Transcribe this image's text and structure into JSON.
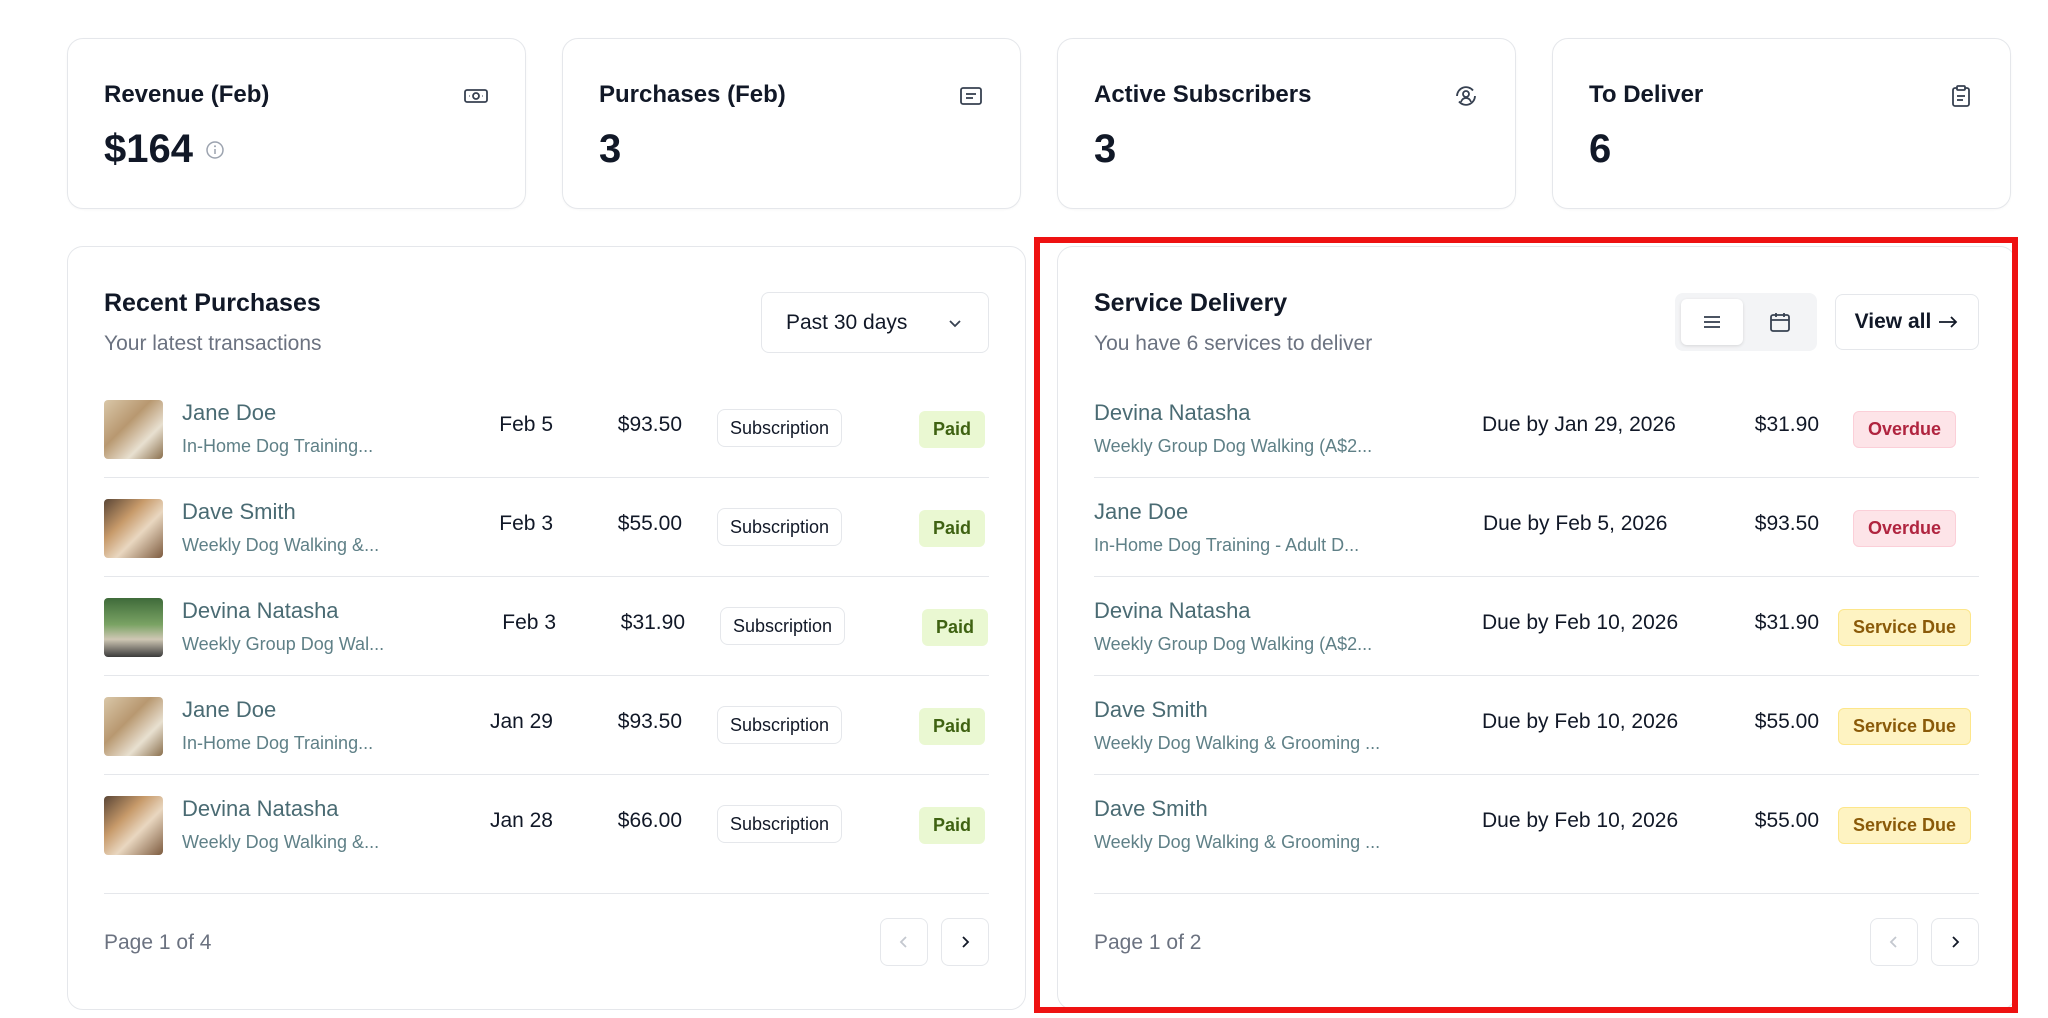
{
  "stats": [
    {
      "title": "Revenue (Feb)",
      "value": "$164",
      "icon": "banknote-icon",
      "has_info": true
    },
    {
      "title": "Purchases (Feb)",
      "value": "3",
      "icon": "receipt-icon"
    },
    {
      "title": "Active Subscribers",
      "value": "3",
      "icon": "user-cycle-icon"
    },
    {
      "title": "To Deliver",
      "value": "6",
      "icon": "clipboard-icon"
    }
  ],
  "recent_purchases": {
    "title": "Recent Purchases",
    "subtitle": "Your latest transactions",
    "filter": "Past 30 days",
    "rows": [
      {
        "name": "Jane Doe",
        "desc": "In-Home Dog Training...",
        "date": "Feb 5",
        "amount": "$93.50",
        "type": "Subscription",
        "status": "Paid"
      },
      {
        "name": "Dave Smith",
        "desc": "Weekly Dog Walking &...",
        "date": "Feb 3",
        "amount": "$55.00",
        "type": "Subscription",
        "status": "Paid"
      },
      {
        "name": "Devina Natasha",
        "desc": "Weekly Group Dog Wal...",
        "date": "Feb 3",
        "amount": "$31.90",
        "type": "Subscription",
        "status": "Paid"
      },
      {
        "name": "Jane Doe",
        "desc": "In-Home Dog Training...",
        "date": "Jan 29",
        "amount": "$93.50",
        "type": "Subscription",
        "status": "Paid"
      },
      {
        "name": "Devina Natasha",
        "desc": "Weekly Dog Walking &...",
        "date": "Jan 28",
        "amount": "$66.00",
        "type": "Subscription",
        "status": "Paid"
      }
    ],
    "pager": "Page 1 of 4"
  },
  "service_delivery": {
    "title": "Service Delivery",
    "subtitle": "You have 6 services to deliver",
    "view_all": "View all",
    "rows": [
      {
        "name": "Devina Natasha",
        "desc": "Weekly Group Dog Walking (A$2...",
        "due": "Due by Jan 29, 2026",
        "amount": "$31.90",
        "status": "Overdue"
      },
      {
        "name": "Jane Doe",
        "desc": "In-Home Dog Training - Adult D...",
        "due": "Due by Feb 5, 2026",
        "amount": "$93.50",
        "status": "Overdue"
      },
      {
        "name": "Devina Natasha",
        "desc": "Weekly Group Dog Walking (A$2...",
        "due": "Due by Feb 10, 2026",
        "amount": "$31.90",
        "status": "Service Due"
      },
      {
        "name": "Dave Smith",
        "desc": "Weekly Dog Walking & Grooming ...",
        "due": "Due by Feb 10, 2026",
        "amount": "$55.00",
        "status": "Service Due"
      },
      {
        "name": "Dave Smith",
        "desc": "Weekly Dog Walking & Grooming ...",
        "due": "Due by Feb 10, 2026",
        "amount": "$55.00",
        "status": "Service Due"
      }
    ],
    "pager": "Page 1 of 2"
  },
  "colors": {
    "highlight": "#ee1111",
    "paid_bg": "#eaf8d2",
    "overdue_bg": "#fde4e8",
    "service_due_bg": "#fef3c2",
    "link": "#4a6b73"
  }
}
